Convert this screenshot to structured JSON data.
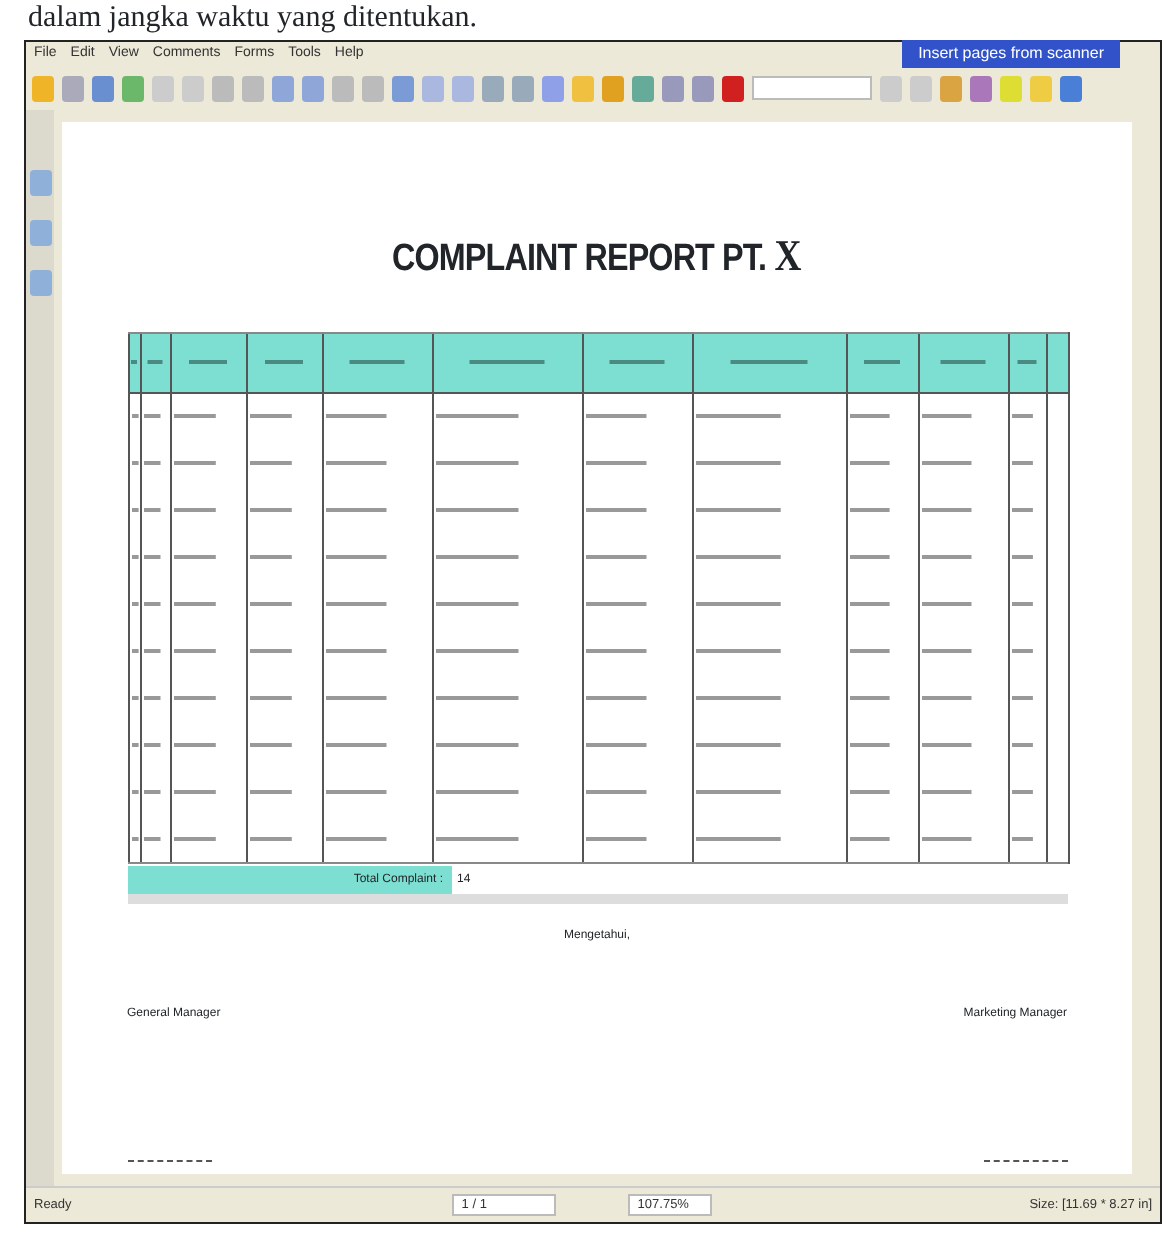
{
  "caption": "dalam jangka waktu yang ditentukan.",
  "menu": [
    "File",
    "Edit",
    "View",
    "Comments",
    "Forms",
    "Tools",
    "Help"
  ],
  "scanner_banner": "Insert pages from scanner",
  "document": {
    "title": "COMPLAINT REPORT PT. ",
    "title_mark": "X",
    "total_label": "Total Complaint :",
    "total_value": "14",
    "acknowledged": "Mengetahui,",
    "signers": [
      "General Manager",
      "Marketing Manager"
    ]
  },
  "status_bar": {
    "state": "Ready",
    "page": "1 / 1",
    "zoom": "107.75%",
    "size": "Size: [11.69 * 8.27 in]"
  }
}
